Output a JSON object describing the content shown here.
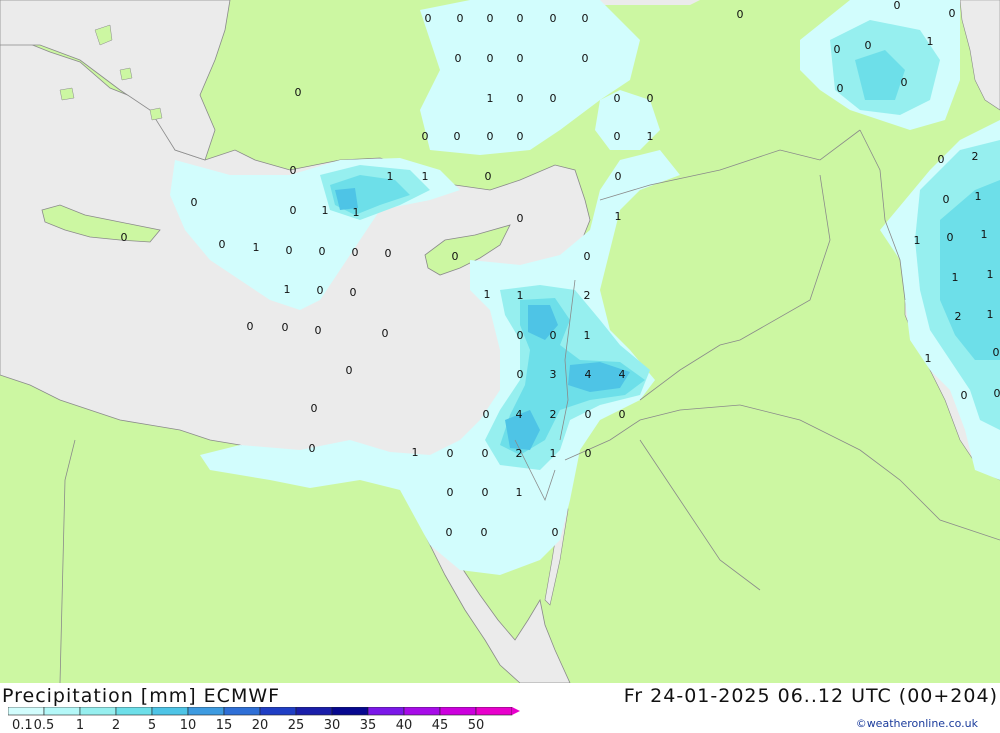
{
  "title": {
    "left": "Precipitation [mm] ECMWF",
    "right": "Fr 24-01-2025 06..12 UTC (00+204)"
  },
  "credit": "©weatheronline.co.uk",
  "legend": {
    "labels": [
      "0.1",
      "0.5",
      "1",
      "2",
      "5",
      "10",
      "15",
      "20",
      "25",
      "30",
      "35",
      "40",
      "45",
      "50"
    ],
    "colors": [
      "#d2fdfd",
      "#b4f8f8",
      "#96efef",
      "#6ddfe9",
      "#4ec4e6",
      "#3e9be0",
      "#2f6fd6",
      "#1f3ec4",
      "#1a1ea9",
      "#07088f",
      "#7b18e8",
      "#a70ce8",
      "#cc00dd",
      "#e800cc"
    ]
  },
  "colors": {
    "land": "#ccf7a2",
    "sea": "#ebebeb",
    "border": "#8a8a8a"
  },
  "map_values": [
    {
      "v": "0"
    },
    {
      "v": "0"
    },
    {
      "v": "0"
    },
    {
      "v": "0"
    },
    {
      "v": "0"
    },
    {
      "v": "0"
    },
    {
      "v": "0"
    },
    {
      "v": "0"
    },
    {
      "v": "0"
    },
    {
      "v": "0"
    },
    {
      "v": "0"
    },
    {
      "v": "0"
    },
    {
      "v": "1"
    },
    {
      "v": "0"
    },
    {
      "v": "0"
    },
    {
      "v": "0"
    },
    {
      "v": "0"
    },
    {
      "v": "0"
    },
    {
      "v": "0"
    },
    {
      "v": "0"
    },
    {
      "v": "0"
    },
    {
      "v": "0"
    },
    {
      "v": "1"
    },
    {
      "v": "0"
    },
    {
      "v": "1"
    },
    {
      "v": "1"
    },
    {
      "v": "0"
    },
    {
      "v": "0"
    },
    {
      "v": "0"
    },
    {
      "v": "0"
    },
    {
      "v": "1"
    },
    {
      "v": "1"
    },
    {
      "v": "0"
    },
    {
      "v": "1"
    },
    {
      "v": "0"
    },
    {
      "v": "0"
    },
    {
      "v": "1"
    },
    {
      "v": "0"
    },
    {
      "v": "0"
    },
    {
      "v": "0"
    },
    {
      "v": "0"
    },
    {
      "v": "0"
    },
    {
      "v": "0"
    },
    {
      "v": "1"
    },
    {
      "v": "0"
    },
    {
      "v": "0"
    },
    {
      "v": "1"
    },
    {
      "v": "1"
    },
    {
      "v": "2"
    },
    {
      "v": "0"
    },
    {
      "v": "0"
    },
    {
      "v": "0"
    },
    {
      "v": "0"
    },
    {
      "v": "0"
    },
    {
      "v": "0"
    },
    {
      "v": "1"
    },
    {
      "v": "0"
    },
    {
      "v": "0"
    },
    {
      "v": "3"
    },
    {
      "v": "4"
    },
    {
      "v": "4"
    },
    {
      "v": "0"
    },
    {
      "v": "0"
    },
    {
      "v": "4"
    },
    {
      "v": "2"
    },
    {
      "v": "0"
    },
    {
      "v": "0"
    },
    {
      "v": "0"
    },
    {
      "v": "1"
    },
    {
      "v": "0"
    },
    {
      "v": "0"
    },
    {
      "v": "2"
    },
    {
      "v": "1"
    },
    {
      "v": "0"
    },
    {
      "v": "0"
    },
    {
      "v": "0"
    },
    {
      "v": "1"
    },
    {
      "v": "0"
    },
    {
      "v": "0"
    },
    {
      "v": "0"
    },
    {
      "v": "0"
    },
    {
      "v": "0"
    },
    {
      "v": "0"
    },
    {
      "v": "0"
    },
    {
      "v": "1"
    },
    {
      "v": "0"
    },
    {
      "v": "0"
    },
    {
      "v": "0"
    },
    {
      "v": "2"
    },
    {
      "v": "0"
    },
    {
      "v": "1"
    },
    {
      "v": "1"
    },
    {
      "v": "0"
    },
    {
      "v": "1"
    },
    {
      "v": "1"
    },
    {
      "v": "1"
    },
    {
      "v": "2"
    },
    {
      "v": "1"
    },
    {
      "v": "1"
    },
    {
      "v": "0"
    },
    {
      "v": "0"
    },
    {
      "v": "0"
    }
  ]
}
